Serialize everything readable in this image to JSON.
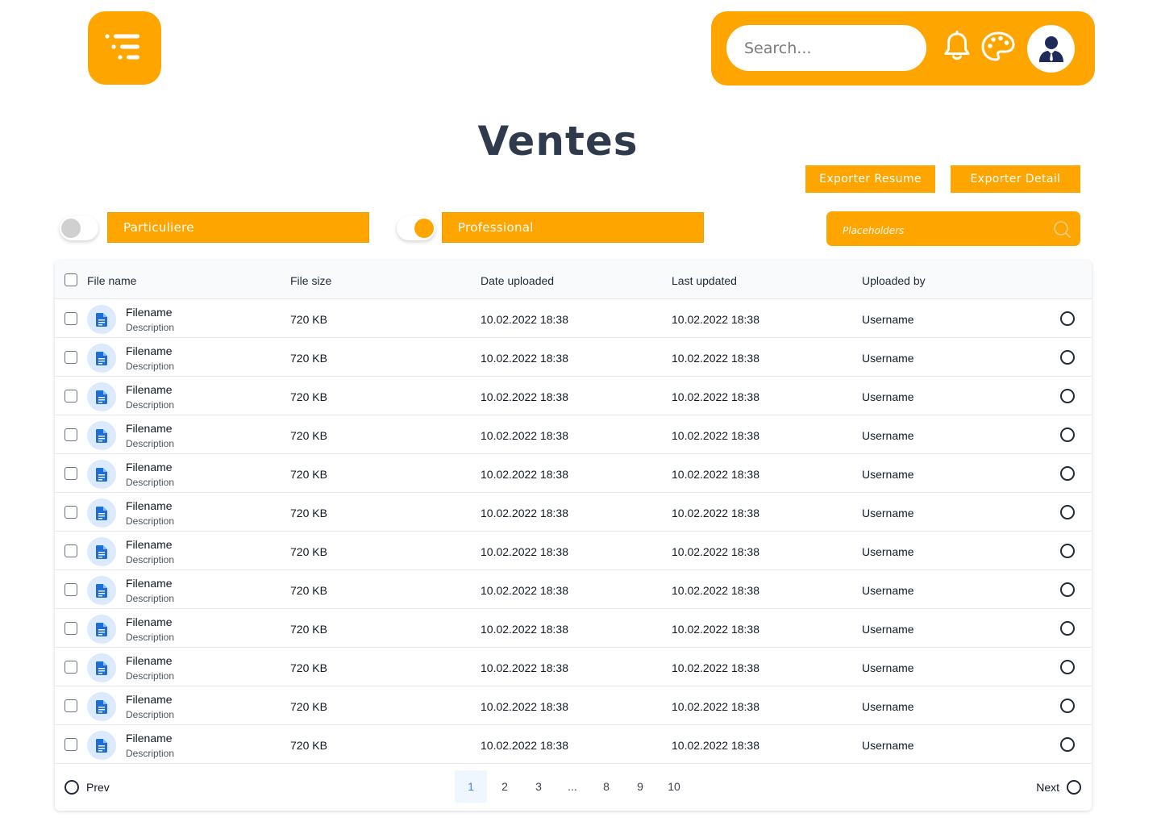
{
  "header": {
    "search_placeholder": "Search...",
    "icons": [
      "menu-icon",
      "bell-icon",
      "palette-icon",
      "user-avatar-icon"
    ],
    "accent_color": "#FFA500"
  },
  "page_title": "Ventes",
  "actions": {
    "export_resume": "Exporter Resume",
    "export_detail": "Exporter Detail"
  },
  "filters": {
    "particuliere": {
      "label": "Particuliere",
      "toggle_on": false
    },
    "professional": {
      "label": "Professional",
      "toggle_on": true
    },
    "search_placeholder": "Placeholders"
  },
  "table": {
    "columns": [
      "File name",
      "File size",
      "Date uploaded",
      "Last updated",
      "Uploaded by"
    ],
    "rows": [
      {
        "name": "Filename",
        "description": "Description",
        "size": "720 KB",
        "uploaded": "10.02.2022 18:38",
        "updated": "10.02.2022 18:38",
        "user": "Username"
      },
      {
        "name": "Filename",
        "description": "Description",
        "size": "720 KB",
        "uploaded": "10.02.2022 18:38",
        "updated": "10.02.2022 18:38",
        "user": "Username"
      },
      {
        "name": "Filename",
        "description": "Description",
        "size": "720 KB",
        "uploaded": "10.02.2022 18:38",
        "updated": "10.02.2022 18:38",
        "user": "Username"
      },
      {
        "name": "Filename",
        "description": "Description",
        "size": "720 KB",
        "uploaded": "10.02.2022 18:38",
        "updated": "10.02.2022 18:38",
        "user": "Username"
      },
      {
        "name": "Filename",
        "description": "Description",
        "size": "720 KB",
        "uploaded": "10.02.2022 18:38",
        "updated": "10.02.2022 18:38",
        "user": "Username"
      },
      {
        "name": "Filename",
        "description": "Description",
        "size": "720 KB",
        "uploaded": "10.02.2022 18:38",
        "updated": "10.02.2022 18:38",
        "user": "Username"
      },
      {
        "name": "Filename",
        "description": "Description",
        "size": "720 KB",
        "uploaded": "10.02.2022 18:38",
        "updated": "10.02.2022 18:38",
        "user": "Username"
      },
      {
        "name": "Filename",
        "description": "Description",
        "size": "720 KB",
        "uploaded": "10.02.2022 18:38",
        "updated": "10.02.2022 18:38",
        "user": "Username"
      },
      {
        "name": "Filename",
        "description": "Description",
        "size": "720 KB",
        "uploaded": "10.02.2022 18:38",
        "updated": "10.02.2022 18:38",
        "user": "Username"
      },
      {
        "name": "Filename",
        "description": "Description",
        "size": "720 KB",
        "uploaded": "10.02.2022 18:38",
        "updated": "10.02.2022 18:38",
        "user": "Username"
      },
      {
        "name": "Filename",
        "description": "Description",
        "size": "720 KB",
        "uploaded": "10.02.2022 18:38",
        "updated": "10.02.2022 18:38",
        "user": "Username"
      },
      {
        "name": "Filename",
        "description": "Description",
        "size": "720 KB",
        "uploaded": "10.02.2022 18:38",
        "updated": "10.02.2022 18:38",
        "user": "Username"
      }
    ]
  },
  "pagination": {
    "prev_label": "Prev",
    "next_label": "Next",
    "pages": [
      "1",
      "2",
      "3",
      "...",
      "8",
      "9",
      "10"
    ],
    "current_page": "1"
  }
}
